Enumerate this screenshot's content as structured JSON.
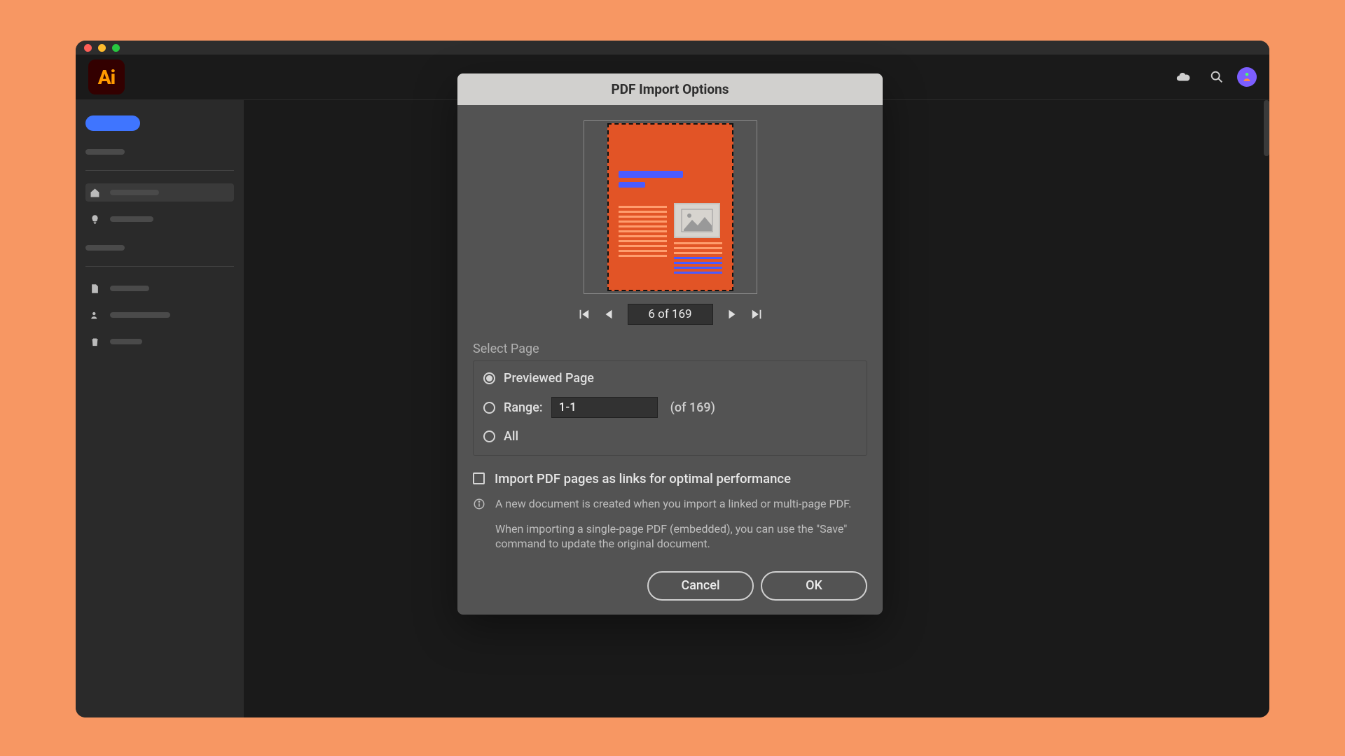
{
  "app": {
    "logo": "Ai"
  },
  "dialog": {
    "title": "PDF Import Options",
    "page_nav": {
      "current": "6 of 169"
    },
    "select_page": {
      "legend": "Select Page",
      "previewed_label": "Previewed Page",
      "range_label": "Range:",
      "range_value": "1-1",
      "range_of": "(of 169)",
      "all_label": "All"
    },
    "import_links_label": "Import PDF pages as links for optimal performance",
    "info_line1": "A new document is created when you import a linked or multi-page PDF.",
    "info_line2": "When importing a single-page PDF (embedded), you can use the \"Save\" command to update the original document.",
    "cancel_label": "Cancel",
    "ok_label": "OK"
  }
}
